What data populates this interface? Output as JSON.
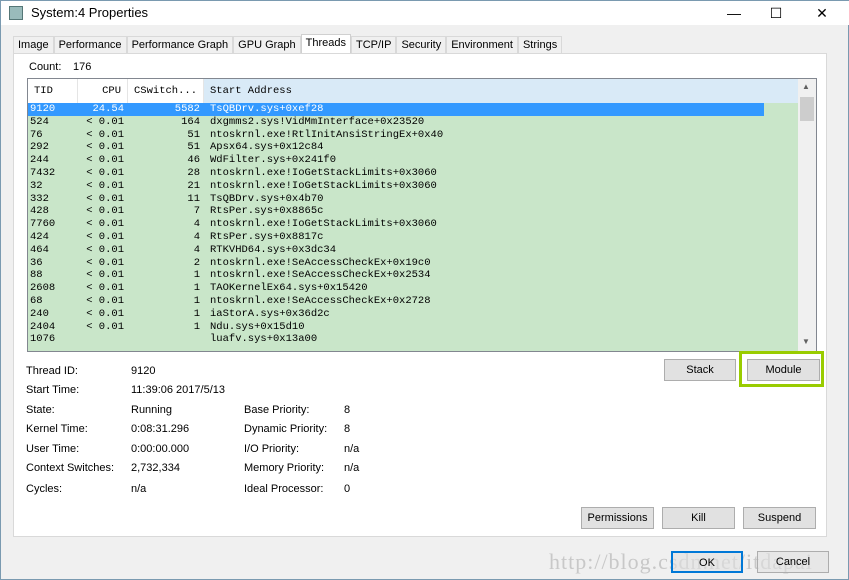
{
  "window": {
    "title": "System:4 Properties",
    "minimize": "—",
    "maximize": "☐",
    "close": "✕"
  },
  "tabs": [
    "Image",
    "Performance",
    "Performance Graph",
    "GPU Graph",
    "Threads",
    "TCP/IP",
    "Security",
    "Environment",
    "Strings"
  ],
  "active_tab": "Threads",
  "count": {
    "label": "Count:",
    "value": "176"
  },
  "columns": [
    "TID",
    "CPU",
    "CSwitch...",
    "Start Address"
  ],
  "rows": [
    [
      "9120",
      "24.54",
      "5582",
      "TsQBDrv.sys+0xef28"
    ],
    [
      "524",
      "< 0.01",
      "164",
      "dxgmms2.sys!VidMmInterface+0x23520"
    ],
    [
      "76",
      "< 0.01",
      "51",
      "ntoskrnl.exe!RtlInitAnsiStringEx+0x40"
    ],
    [
      "292",
      "< 0.01",
      "51",
      "Apsx64.sys+0x12c84"
    ],
    [
      "244",
      "< 0.01",
      "46",
      "WdFilter.sys+0x241f0"
    ],
    [
      "7432",
      "< 0.01",
      "28",
      "ntoskrnl.exe!IoGetStackLimits+0x3060"
    ],
    [
      "32",
      "< 0.01",
      "21",
      "ntoskrnl.exe!IoGetStackLimits+0x3060"
    ],
    [
      "332",
      "< 0.01",
      "11",
      "TsQBDrv.sys+0x4b70"
    ],
    [
      "428",
      "< 0.01",
      "7",
      "RtsPer.sys+0x8865c"
    ],
    [
      "7760",
      "< 0.01",
      "4",
      "ntoskrnl.exe!IoGetStackLimits+0x3060"
    ],
    [
      "424",
      "< 0.01",
      "4",
      "RtsPer.sys+0x8817c"
    ],
    [
      "464",
      "< 0.01",
      "4",
      "RTKVHD64.sys+0x3dc34"
    ],
    [
      "36",
      "< 0.01",
      "2",
      "ntoskrnl.exe!SeAccessCheckEx+0x19c0"
    ],
    [
      "88",
      "< 0.01",
      "1",
      "ntoskrnl.exe!SeAccessCheckEx+0x2534"
    ],
    [
      "2608",
      "< 0.01",
      "1",
      "TAOKernelEx64.sys+0x15420"
    ],
    [
      "68",
      "< 0.01",
      "1",
      "ntoskrnl.exe!SeAccessCheckEx+0x2728"
    ],
    [
      "240",
      "< 0.01",
      "1",
      "iaStorA.sys+0x36d2c"
    ],
    [
      "2404",
      "< 0.01",
      "1",
      "Ndu.sys+0x15d10"
    ],
    [
      "1076",
      "",
      "",
      "luafv.sys+0x13a00"
    ]
  ],
  "details": {
    "thread_id": {
      "label": "Thread ID:",
      "value": "9120"
    },
    "start_time": {
      "label": "Start Time:",
      "value": "11:39:06  2017/5/13"
    },
    "state": {
      "label": "State:",
      "value": "Running"
    },
    "kernel_time": {
      "label": "Kernel Time:",
      "value": "0:08:31.296"
    },
    "user_time": {
      "label": "User Time:",
      "value": "0:00:00.000"
    },
    "context_switches": {
      "label": "Context Switches:",
      "value": "2,732,334"
    },
    "cycles": {
      "label": "Cycles:",
      "value": "n/a"
    },
    "base_priority": {
      "label": "Base Priority:",
      "value": "8"
    },
    "dynamic_priority": {
      "label": "Dynamic Priority:",
      "value": "8"
    },
    "io_priority": {
      "label": "I/O Priority:",
      "value": "n/a"
    },
    "memory_priority": {
      "label": "Memory Priority:",
      "value": "n/a"
    },
    "ideal_processor": {
      "label": "Ideal Processor:",
      "value": "0"
    }
  },
  "buttons": {
    "stack": "Stack",
    "module": "Module",
    "permissions": "Permissions",
    "kill": "Kill",
    "suspend": "Suspend",
    "ok": "OK",
    "cancel": "Cancel"
  },
  "watermark": "http://blog.csdn.net/itdapai",
  "colors": {
    "list_bg": "#c9e6c9",
    "selection": "#3399ff",
    "highlight": "#99cc00"
  }
}
